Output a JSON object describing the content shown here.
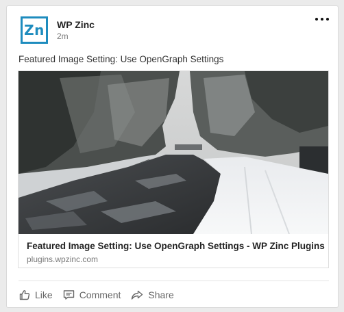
{
  "post": {
    "author": "WP Zinc",
    "avatar_text": "Zn",
    "timestamp": "2m",
    "text": "Featured Image Setting: Use OpenGraph Settings"
  },
  "link_preview": {
    "title": "Featured Image Setting: Use OpenGraph Settings - WP Zinc Plugins",
    "domain": "plugins.wpzinc.com"
  },
  "actions": {
    "like": "Like",
    "comment": "Comment",
    "share": "Share"
  },
  "icons": {
    "more": "more-horizontal-icon",
    "like": "thumbs-up-icon",
    "comment": "comment-icon",
    "share": "share-arrow-icon"
  },
  "colors": {
    "brand": "#1e8cbe",
    "text": "#222222",
    "muted": "#7a7a7a"
  }
}
